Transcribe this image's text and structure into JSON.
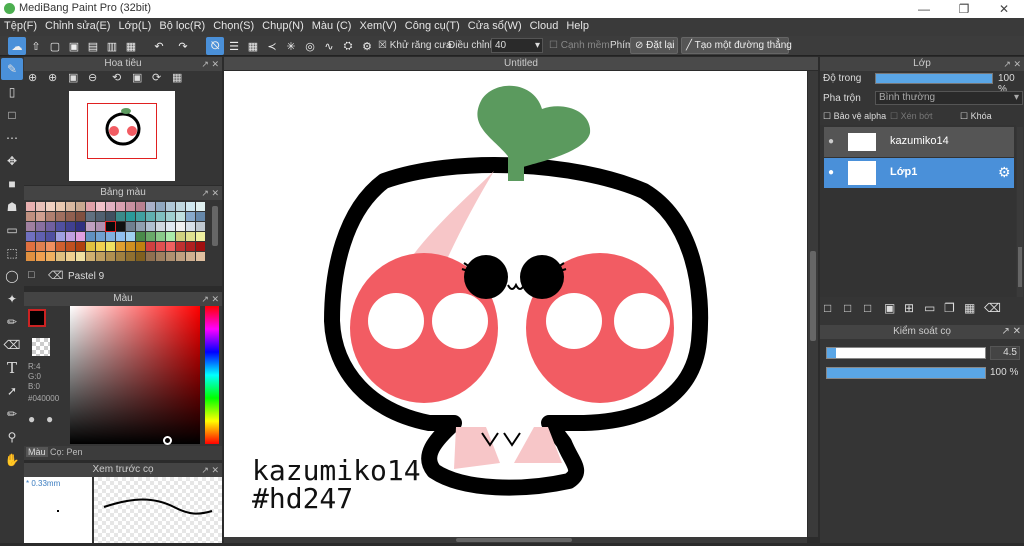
{
  "window": {
    "title": "MediBang Paint Pro (32bit)"
  },
  "menu": [
    "Tệp(F)",
    "Chỉnh sửa(E)",
    "Lớp(L)",
    "Bộ lọc(R)",
    "Chọn(S)",
    "Chụp(N)",
    "Màu (C)",
    "Xem(V)",
    "Công cụ(T)",
    "Cửa sổ(W)",
    "Cloud",
    "Help"
  ],
  "toolbar": {
    "antialias_label": "Khử răng cưa",
    "adjust_label": "Điều chỉnh",
    "adjust_value": "40",
    "edge_label": "Cạnh mềm",
    "key_label": "Phím",
    "reset_label": "Đặt lại",
    "straight_line_label": "Tạo một đường thẳng"
  },
  "navigator": {
    "title": "Hoa tiêu"
  },
  "palette": {
    "title": "Bảng màu",
    "name": "Pastel 9"
  },
  "color": {
    "title": "Màu",
    "r": "R:4",
    "g": "G:0",
    "b": "B:0",
    "hex": "#040000",
    "tab_color": "Màu",
    "tab_brush": "Cọ: Pen"
  },
  "brush_preview": {
    "title": "Xem trước cọ",
    "size": "* 0.33mm"
  },
  "canvas": {
    "tab": "Untitled",
    "signature_line1": "kazumiko14",
    "signature_line2": "#hd247"
  },
  "layers": {
    "title": "Lớp",
    "opacity_label": "Độ trong",
    "opacity_value": "100 %",
    "opacity_fraction": 1.0,
    "blend_label": "Pha trộn",
    "blend_value": "Bình thường",
    "protect_alpha": "Bảo vệ alpha",
    "clip": "Xén bớt",
    "lock": "Khóa",
    "items": [
      {
        "name": "kazumiko14",
        "selected": false
      },
      {
        "name": "Lớp1",
        "selected": true
      }
    ]
  },
  "brush_control": {
    "title": "Kiểm soát cọ",
    "size_value": "4.5",
    "size_fraction": 0.06,
    "opacity_value": "100 %",
    "opacity_fraction": 1.0
  },
  "colors": {
    "accent": "#4a90d9",
    "panel": "#353535",
    "cheek": "#f25c63",
    "leaf": "#5b9a5e"
  }
}
